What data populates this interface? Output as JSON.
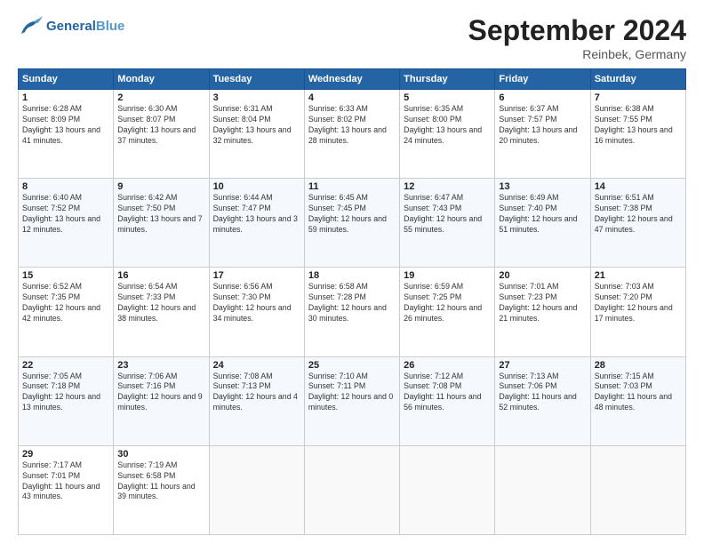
{
  "header": {
    "logo_general": "General",
    "logo_blue": "Blue",
    "month_year": "September 2024",
    "location": "Reinbek, Germany"
  },
  "days_of_week": [
    "Sunday",
    "Monday",
    "Tuesday",
    "Wednesday",
    "Thursday",
    "Friday",
    "Saturday"
  ],
  "weeks": [
    [
      {
        "day": "1",
        "sunrise": "6:28 AM",
        "sunset": "8:09 PM",
        "daylight": "13 hours and 41 minutes."
      },
      {
        "day": "2",
        "sunrise": "6:30 AM",
        "sunset": "8:07 PM",
        "daylight": "13 hours and 37 minutes."
      },
      {
        "day": "3",
        "sunrise": "6:31 AM",
        "sunset": "8:04 PM",
        "daylight": "13 hours and 32 minutes."
      },
      {
        "day": "4",
        "sunrise": "6:33 AM",
        "sunset": "8:02 PM",
        "daylight": "13 hours and 28 minutes."
      },
      {
        "day": "5",
        "sunrise": "6:35 AM",
        "sunset": "8:00 PM",
        "daylight": "13 hours and 24 minutes."
      },
      {
        "day": "6",
        "sunrise": "6:37 AM",
        "sunset": "7:57 PM",
        "daylight": "13 hours and 20 minutes."
      },
      {
        "day": "7",
        "sunrise": "6:38 AM",
        "sunset": "7:55 PM",
        "daylight": "13 hours and 16 minutes."
      }
    ],
    [
      {
        "day": "8",
        "sunrise": "6:40 AM",
        "sunset": "7:52 PM",
        "daylight": "13 hours and 12 minutes."
      },
      {
        "day": "9",
        "sunrise": "6:42 AM",
        "sunset": "7:50 PM",
        "daylight": "13 hours and 7 minutes."
      },
      {
        "day": "10",
        "sunrise": "6:44 AM",
        "sunset": "7:47 PM",
        "daylight": "13 hours and 3 minutes."
      },
      {
        "day": "11",
        "sunrise": "6:45 AM",
        "sunset": "7:45 PM",
        "daylight": "12 hours and 59 minutes."
      },
      {
        "day": "12",
        "sunrise": "6:47 AM",
        "sunset": "7:43 PM",
        "daylight": "12 hours and 55 minutes."
      },
      {
        "day": "13",
        "sunrise": "6:49 AM",
        "sunset": "7:40 PM",
        "daylight": "12 hours and 51 minutes."
      },
      {
        "day": "14",
        "sunrise": "6:51 AM",
        "sunset": "7:38 PM",
        "daylight": "12 hours and 47 minutes."
      }
    ],
    [
      {
        "day": "15",
        "sunrise": "6:52 AM",
        "sunset": "7:35 PM",
        "daylight": "12 hours and 42 minutes."
      },
      {
        "day": "16",
        "sunrise": "6:54 AM",
        "sunset": "7:33 PM",
        "daylight": "12 hours and 38 minutes."
      },
      {
        "day": "17",
        "sunrise": "6:56 AM",
        "sunset": "7:30 PM",
        "daylight": "12 hours and 34 minutes."
      },
      {
        "day": "18",
        "sunrise": "6:58 AM",
        "sunset": "7:28 PM",
        "daylight": "12 hours and 30 minutes."
      },
      {
        "day": "19",
        "sunrise": "6:59 AM",
        "sunset": "7:25 PM",
        "daylight": "12 hours and 26 minutes."
      },
      {
        "day": "20",
        "sunrise": "7:01 AM",
        "sunset": "7:23 PM",
        "daylight": "12 hours and 21 minutes."
      },
      {
        "day": "21",
        "sunrise": "7:03 AM",
        "sunset": "7:20 PM",
        "daylight": "12 hours and 17 minutes."
      }
    ],
    [
      {
        "day": "22",
        "sunrise": "7:05 AM",
        "sunset": "7:18 PM",
        "daylight": "12 hours and 13 minutes."
      },
      {
        "day": "23",
        "sunrise": "7:06 AM",
        "sunset": "7:16 PM",
        "daylight": "12 hours and 9 minutes."
      },
      {
        "day": "24",
        "sunrise": "7:08 AM",
        "sunset": "7:13 PM",
        "daylight": "12 hours and 4 minutes."
      },
      {
        "day": "25",
        "sunrise": "7:10 AM",
        "sunset": "7:11 PM",
        "daylight": "12 hours and 0 minutes."
      },
      {
        "day": "26",
        "sunrise": "7:12 AM",
        "sunset": "7:08 PM",
        "daylight": "11 hours and 56 minutes."
      },
      {
        "day": "27",
        "sunrise": "7:13 AM",
        "sunset": "7:06 PM",
        "daylight": "11 hours and 52 minutes."
      },
      {
        "day": "28",
        "sunrise": "7:15 AM",
        "sunset": "7:03 PM",
        "daylight": "11 hours and 48 minutes."
      }
    ],
    [
      {
        "day": "29",
        "sunrise": "7:17 AM",
        "sunset": "7:01 PM",
        "daylight": "11 hours and 43 minutes."
      },
      {
        "day": "30",
        "sunrise": "7:19 AM",
        "sunset": "6:58 PM",
        "daylight": "11 hours and 39 minutes."
      },
      null,
      null,
      null,
      null,
      null
    ]
  ]
}
